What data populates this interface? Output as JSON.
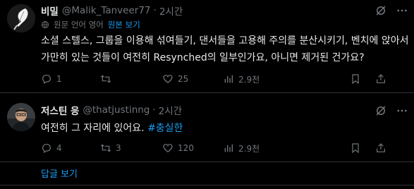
{
  "tweets": [
    {
      "display_name": "비밀",
      "handle": "@Malik_Tanveer77",
      "separator": "·",
      "time": "2시간",
      "translate": {
        "label": "원문 언어 영어",
        "link": "원본 보기"
      },
      "text": "소셜 스텔스, 그룹을 이용해 섞여들기, 댄서들을 고용해 주의를 분산시키기, 벤치에 앉아서 가만히 있는 것들이 여전히 Resynched의 일부인가요, 아니면 제거된 건가요?",
      "replies": "1",
      "retweets": "",
      "likes": "25",
      "views": "2.9천",
      "avatar_icon": "feather-quill-icon"
    },
    {
      "display_name": "저스틴 응",
      "handle": "@thatjustinng",
      "separator": "·",
      "time": "2시간",
      "text_plain": "여전히 그 자리에 있어요.",
      "hashtag": "#충실한",
      "replies": "4",
      "retweets": "3",
      "likes": "120",
      "views": "2.9천",
      "avatar_icon": "person-photo-icon"
    }
  ],
  "show_replies_label": "답글 보기",
  "colors": {
    "background": "#000000",
    "text": "#e7e9ea",
    "muted": "#71767b",
    "accent": "#1d9bf0",
    "divider": "#2f3336"
  }
}
